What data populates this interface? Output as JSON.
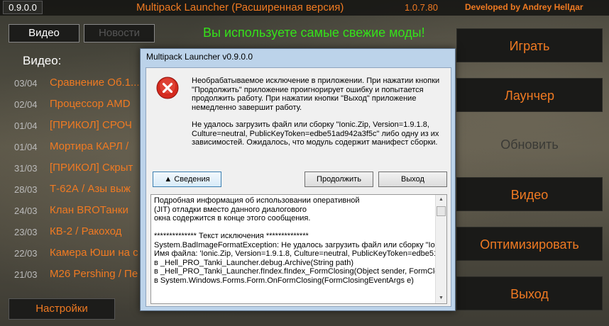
{
  "topbar": {
    "version": "0.9.0.0",
    "title": "Multipack Launcher (Расширенная версия)",
    "build": "1.0.7.80",
    "credit": "Developed by Andrey Hellдаr"
  },
  "tabs": [
    {
      "label": "Видео",
      "active": true
    },
    {
      "label": "Новости",
      "active": false
    }
  ],
  "status": "Вы используете самые свежие моды!",
  "video_section": {
    "label": "Видео:",
    "items": [
      {
        "date": "03/04",
        "title": "Сравнение Об.1..."
      },
      {
        "date": "02/04",
        "title": "Процессор AMD"
      },
      {
        "date": "01/04",
        "title": "[ПРИКОЛ] СРОЧ"
      },
      {
        "date": "01/04",
        "title": "Мортира КАРЛ /"
      },
      {
        "date": "31/03",
        "title": "[ПРИКОЛ] Скрыт"
      },
      {
        "date": "28/03",
        "title": "Т-62А / Азы выж"
      },
      {
        "date": "24/03",
        "title": "Клан BROТанки"
      },
      {
        "date": "23/03",
        "title": "КВ-2 / Ракоход"
      },
      {
        "date": "22/03",
        "title": "Камера Юши на с"
      },
      {
        "date": "21/03",
        "title": "M26 Pershing / Пе"
      }
    ]
  },
  "settings_label": "Настройки",
  "menu": [
    {
      "label": "Играть",
      "enabled": true
    },
    {
      "label": "Лаунчер",
      "enabled": true
    },
    {
      "label": "Обновить",
      "enabled": false
    },
    {
      "label": "Видео",
      "enabled": true
    },
    {
      "label": "Оптимизировать",
      "enabled": true
    },
    {
      "label": "Выход",
      "enabled": true
    }
  ],
  "dialog": {
    "title": "Multipack Launcher v0.9.0.0",
    "icon": "error-icon",
    "message_1": "Необрабатываемое исключение в приложении. При нажатии кнопки \"Продолжить\" приложение проигнорирует ошибку и попытается продолжить работу. При нажатии кнопки \"Выход\" приложение немедленно завершит работу.",
    "message_2": "Не удалось загрузить файл или сборку \"Ionic.Zip, Version=1.9.1.8, Culture=neutral, PublicKeyToken=edbe51ad942a3f5c\" либо одну из их зависимостей. Ожидалось, что модуль содержит манифест сборки.",
    "details_label": "Сведения",
    "continue_label": "Продолжить",
    "exit_label": "Выход",
    "details_lines": [
      "Подробная информация об использовании оперативной",
      "(JIT) отладки вместо данного диалогового",
      "окна содержится в конце этого сообщения.",
      "",
      "************** Текст исключения **************",
      "System.BadImageFormatException: Не удалось загрузить файл или сборку \"Ionic",
      "Имя файла: 'Ionic.Zip, Version=1.9.1.8, Culture=neutral, PublicKeyToken=edbe51ac",
      "   в _Hell_PRO_Tanki_Launcher.debug.Archive(String path)",
      "   в _Hell_PRO_Tanki_Launcher.fIndex.fIndex_FormClosing(Object sender, FormClos",
      "   в System.Windows.Forms.Form.OnFormClosing(FormClosingEventArgs e)"
    ]
  }
}
